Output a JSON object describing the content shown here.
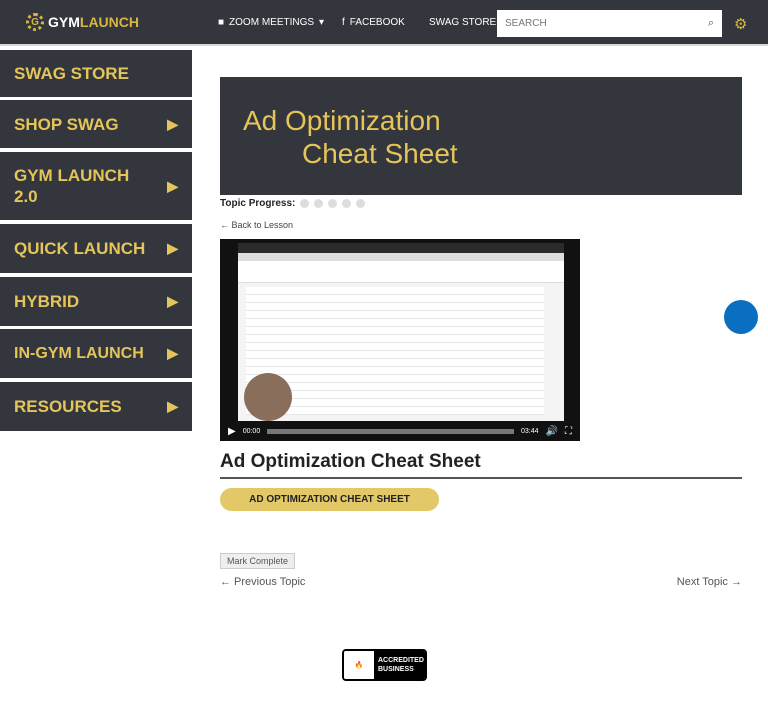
{
  "header": {
    "logo_a": "GYM",
    "logo_b": "LAUNCH",
    "nav": [
      {
        "label": "ZOOM MEETINGS",
        "icon": "video-icon"
      },
      {
        "label": "FACEBOOK",
        "icon": "facebook-icon"
      },
      {
        "label": "SWAG STORE"
      }
    ],
    "search_placeholder": "SEARCH"
  },
  "sidebar": {
    "items": [
      {
        "label": "SWAG STORE"
      },
      {
        "label": "SHOP SWAG"
      },
      {
        "label": "GYM LAUNCH 2.0"
      },
      {
        "label": "QUICK LAUNCH"
      },
      {
        "label": "HYBRID"
      },
      {
        "label": "IN-GYM LAUNCH"
      },
      {
        "label": "RESOURCES"
      }
    ]
  },
  "banner": {
    "line1": "Ad Optimization",
    "line2": "Cheat Sheet"
  },
  "progress": {
    "label": "Topic Progress:",
    "completed": 0,
    "total": 5
  },
  "back_link": "← Back to Lesson",
  "video": {
    "current": "00:00",
    "duration": "03:44"
  },
  "title": "Ad Optimization Cheat Sheet",
  "download_button": "AD OPTIMIZATION CHEAT SHEET",
  "mark_complete": "Mark Complete",
  "prev": "← Previous Topic",
  "next": "Next Topic →",
  "bbb": {
    "logo": "BBB",
    "text1": "ACCREDITED",
    "text2": "BUSINESS"
  },
  "colors": {
    "dark": "#33363c",
    "gold": "#e5c45a"
  }
}
